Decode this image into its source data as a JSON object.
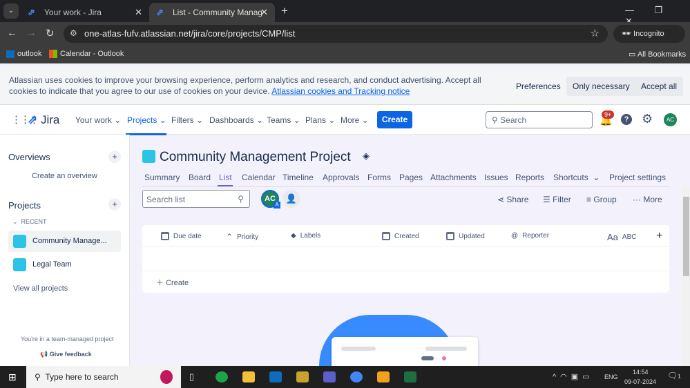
{
  "browser": {
    "tabs": [
      {
        "title": "Your work - Jira"
      },
      {
        "title": "List - Community Management"
      }
    ],
    "url": "one-atlas-fufv.atlassian.net/jira/core/projects/CMP/list",
    "incognito": "Incognito",
    "bookmarks": [
      "outlook",
      "Calendar - Outlook"
    ],
    "all_bookmarks": "All Bookmarks"
  },
  "cookie": {
    "text": "Atlassian uses cookies to improve your browsing experience, perform analytics and research, and conduct advertising. Accept all cookies to indicate that you agree to our use of cookies on your device.",
    "link": "Atlassian cookies and Tracking notice",
    "preferences": "Preferences",
    "only_necessary": "Only necessary",
    "accept_all": "Accept all"
  },
  "nav": {
    "logo": "Jira",
    "items": [
      "Your work",
      "Projects",
      "Filters",
      "Dashboards",
      "Teams",
      "Plans",
      "More"
    ],
    "create": "Create",
    "search_placeholder": "Search",
    "notif_badge": "9+",
    "avatar": "AC"
  },
  "sidebar": {
    "overviews": "Overviews",
    "create_overview": "Create an overview",
    "projects": "Projects",
    "recent": "RECENT",
    "items": [
      "Community Manage...",
      "Legal Team"
    ],
    "view_all": "View all projects",
    "team_managed": "You're in a team-managed project",
    "feedback": "Give feedback"
  },
  "project": {
    "title": "Community Management Project",
    "tabs": [
      "Summary",
      "Board",
      "List",
      "Calendar",
      "Timeline",
      "Approvals",
      "Forms",
      "Pages",
      "Attachments",
      "Issues",
      "Reports",
      "Shortcuts",
      "Project settings"
    ],
    "search_placeholder": "Search list",
    "avatar": "AC",
    "avatar_badge": "A",
    "share": "Share",
    "filter": "Filter",
    "group": "Group",
    "more": "More"
  },
  "table": {
    "columns": [
      "Due date",
      "Priority",
      "Labels",
      "Created",
      "Updated",
      "Reporter",
      "ABC"
    ],
    "abc_icon": "Aa",
    "create": "Create"
  },
  "taskbar": {
    "search": "Type here to search",
    "lang": "ENG",
    "time": "14:54",
    "date": "09-07-2024",
    "notif": "1"
  },
  "colors": {
    "accent": "#0c66e4",
    "bg": "#f3f2fc"
  }
}
